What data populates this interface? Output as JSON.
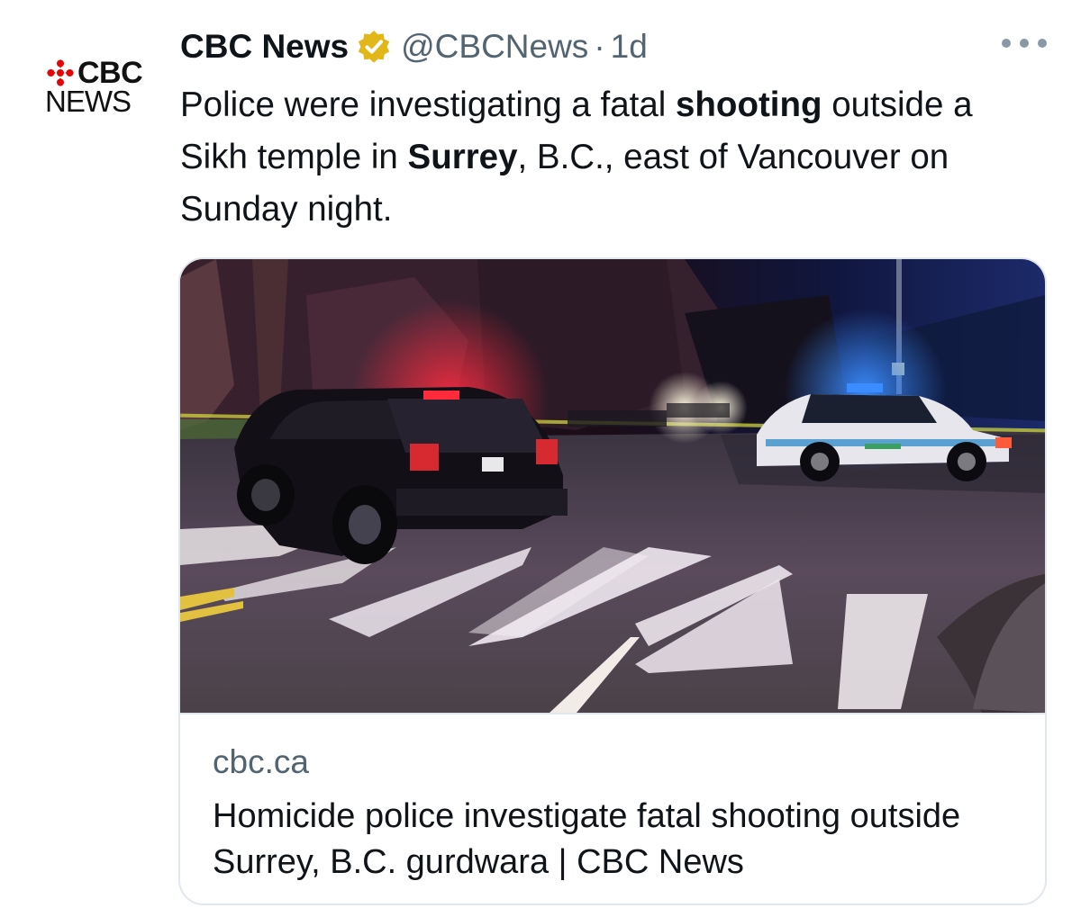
{
  "author": {
    "display_name": "CBC News",
    "handle": "@CBCNews",
    "separator": "·",
    "timestamp": "1d",
    "verified": true,
    "avatar": {
      "logo_text": "CBC",
      "logo_subtext": "NEWS"
    }
  },
  "tweet": {
    "segments": [
      {
        "text": "Police were investigating a fatal ",
        "bold": false
      },
      {
        "text": "shooting",
        "bold": true
      },
      {
        "text": " outside a Sikh temple in ",
        "bold": false
      },
      {
        "text": "Surrey",
        "bold": true
      },
      {
        "text": ", B.C., east of Vancouver on Sunday night.",
        "bold": false
      }
    ]
  },
  "link_card": {
    "domain": "cbc.ca",
    "title": "Homicide police investigate fatal shooting outside Surrey, B.C. gurdwara | CBC News",
    "image": "night-police-scene"
  },
  "icons": {
    "more": "more-horizontal-icon",
    "verified": "verified-badge-icon"
  },
  "colors": {
    "text_primary": "#0f1419",
    "text_secondary": "#536471",
    "verified_gold": "#e2b719",
    "cbc_red": "#e60505",
    "card_border": "#e1e8ed"
  }
}
